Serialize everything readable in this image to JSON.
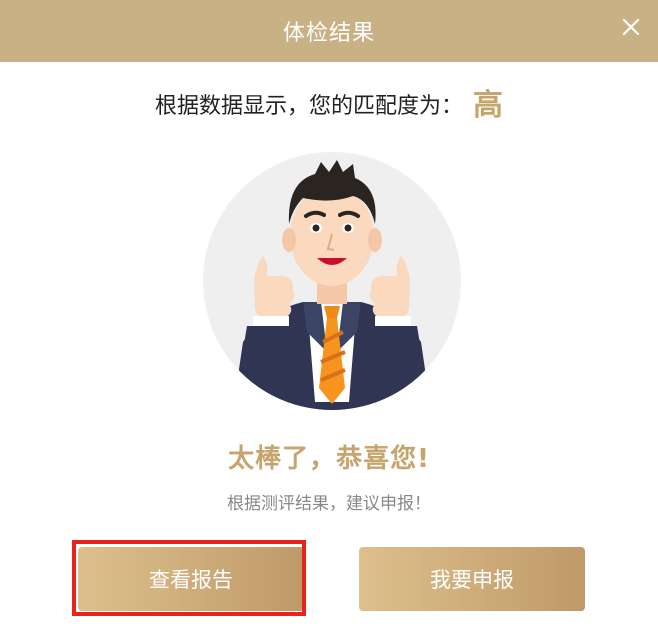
{
  "dialog": {
    "title": "体检结果",
    "close_icon": "close-icon"
  },
  "result": {
    "text": "根据数据显示，您的匹配度为：",
    "level": "高"
  },
  "illustration": {
    "icon": "businessman-thumbs-up-illustration"
  },
  "congrats": "太棒了，恭喜您!",
  "suggestion": "根据测评结果，建议申报！",
  "buttons": {
    "view_report": "查看报告",
    "apply": "我要申报"
  },
  "colors": {
    "header_bg": "#c8b184",
    "accent_gold": "#c5a56d",
    "button_gradient_start": "#ddc08d",
    "button_gradient_end": "#bf9a68",
    "highlight": "#e8231c"
  }
}
